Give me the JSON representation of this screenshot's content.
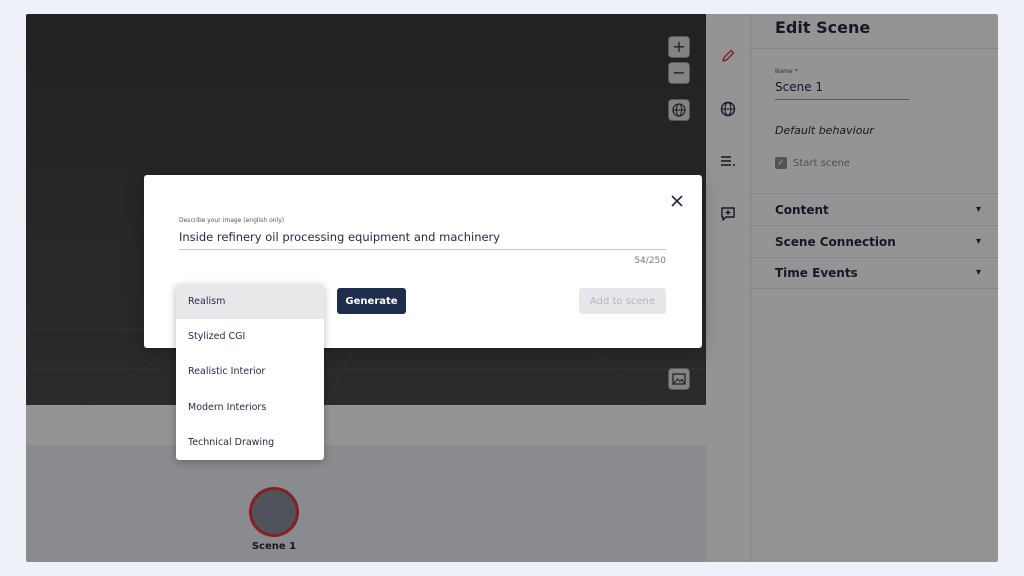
{
  "panel": {
    "title": "Edit Scene",
    "name_label": "Name *",
    "name_value": "Scene 1",
    "default_behaviour": "Default behaviour",
    "start_scene_label": "Start scene",
    "sections": [
      {
        "label": "Content"
      },
      {
        "label": "Scene Connection"
      },
      {
        "label": "Time Events"
      }
    ]
  },
  "timeline": {
    "node_label": "Scene 1"
  },
  "modal": {
    "prompt_label": "Describe your image (english only)",
    "prompt_value": "Inside refinery oil processing equipment and machinery",
    "char_count": "54/250",
    "generate_label": "Generate",
    "add_label": "Add to scene"
  },
  "style_dropdown": {
    "selected": "Realism",
    "options": [
      "Realism",
      "Stylized CGI",
      "Realistic Interior",
      "Modern Interiors",
      "Technical Drawing"
    ]
  },
  "icons": {
    "zoom_in": "plus-icon",
    "zoom_out": "minus-icon",
    "globe_small": "globe-icon",
    "media": "image-icon",
    "edit": "pencil-icon",
    "globe": "globe-icon",
    "list": "list-icon",
    "comment": "comment-add-icon",
    "close": "close-icon",
    "chevron": "chevron-down-icon"
  },
  "colors": {
    "primary": "#1f2e4c",
    "accent_red": "#e33a3a",
    "text_dark": "#1f2a40"
  }
}
